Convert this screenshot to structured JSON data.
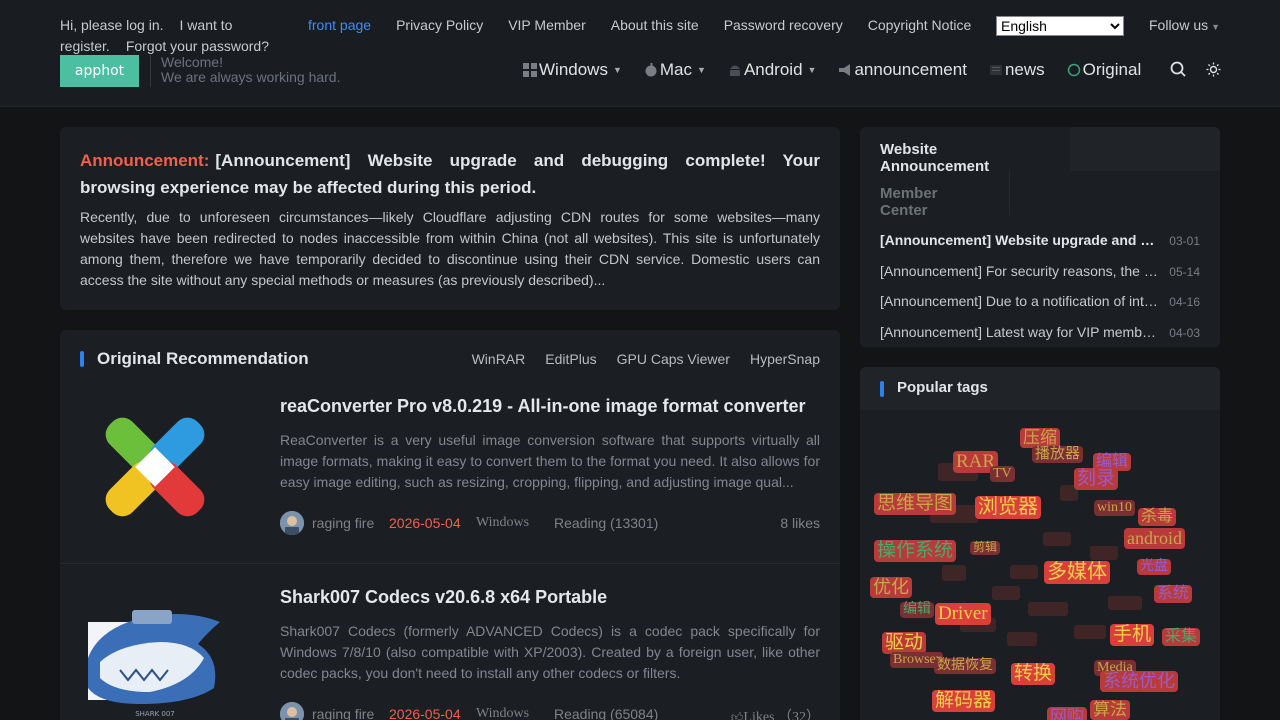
{
  "topbar": {
    "login_prompt": "Hi, please log in.",
    "i_want_to_register": "I want to register.",
    "forgot_password": "Forgot your password?",
    "links": [
      "front page",
      "Privacy Policy",
      "VIP Member",
      "About this site",
      "Password recovery",
      "Copyright Notice"
    ],
    "language_selected": "English",
    "follow_us": "Follow us"
  },
  "brand": {
    "logo_text": "apphot",
    "welcome_line1": "Welcome!",
    "welcome_line2": "We are always working hard."
  },
  "nav": {
    "windows": "Windows",
    "mac": "Mac",
    "android": "Android",
    "announcement": "announcement",
    "news": "news",
    "original": "Original"
  },
  "announcement": {
    "label": "Announcement:",
    "title": "[Announcement] Website upgrade and debugging complete! Your browsing experience may be affected during this period.",
    "body": "Recently, due to unforeseen circumstances—likely Cloudflare adjusting CDN routes for some websites—many websites have been redirected to nodes inaccessible from within China (not all websites). This site is unfortunately among them, therefore we have temporarily decided to discontinue using their CDN service. Domestic users can access the site without any special methods or measures (as previously described)..."
  },
  "recommendation": {
    "title": "Original Recommendation",
    "tabs": [
      "WinRAR",
      "EditPlus",
      "GPU Caps Viewer",
      "HyperSnap"
    ],
    "posts": [
      {
        "title": "reaConverter Pro v8.0.219 - All-in-one image format converter",
        "desc": "ReaConverter is a very useful image conversion software that supports virtually all image formats, making it easy to convert them to the format you need. It also allows for easy image editing, such as resizing, cropping, flipping, and adjusting image qual...",
        "author": "raging fire",
        "date": "2026-05-04",
        "category": "Windows",
        "reads": "Reading (13301)",
        "likes": "8   likes"
      },
      {
        "title": "Shark007 Codecs v20.6.8 x64 Portable",
        "desc": "Shark007 Codecs (formerly ADVANCED Codecs) is a codec pack specifically for Windows 7/8/10 (also compatible with XP/2003). Created by a foreign user, like other codec packs, you don't need to install any other codecs or filters.",
        "author": "raging fire",
        "date": "2026-05-04",
        "category": "Windows",
        "reads": "Reading (65084)",
        "likes": "Likes （32）",
        "thumb_caption": "SHARK 007"
      }
    ]
  },
  "website_announcement": {
    "tab_active": "Website Announcement",
    "tab_member": "Member Center",
    "items": [
      {
        "title": "[Announcement] Website upgrade and debugging complete!",
        "date": "03-01"
      },
      {
        "title": "[Announcement] For security reasons, the website has been updated",
        "date": "05-14"
      },
      {
        "title": "[Announcement] Due to a notification of interruption of service",
        "date": "04-16"
      },
      {
        "title": "[Announcement] Latest way for VIP members to get access",
        "date": "04-03"
      }
    ]
  },
  "popular_tags": {
    "title": "Popular tags",
    "tags": [
      {
        "text": "压缩",
        "color": "#c9a64a",
        "bg": "#b83a3a"
      },
      {
        "text": "RAR",
        "color": "#c9a64a",
        "bg": "#b83a3a"
      },
      {
        "text": "播放器",
        "color": "#c9a64a",
        "bg": "#7a2f32"
      },
      {
        "text": "编辑",
        "color": "#9a5bc8",
        "bg": "#b83a3a"
      },
      {
        "text": "TV",
        "color": "#c9a64a",
        "bg": "#7a2f32"
      },
      {
        "text": "刻录",
        "color": "#9a5bc8",
        "bg": "#b83a3a"
      },
      {
        "text": "思维导图",
        "color": "#c9a64a",
        "bg": "#b83a3a"
      },
      {
        "text": "浏览器",
        "color": "#f0d04a",
        "bg": "#d9403a"
      },
      {
        "text": "win10",
        "color": "#c9a64a",
        "bg": "#7a2f32"
      },
      {
        "text": "杀毒",
        "color": "#c9a64a",
        "bg": "#b83a3a"
      },
      {
        "text": "android",
        "color": "#c9a64a",
        "bg": "#b83a3a"
      },
      {
        "text": "操作系统",
        "color": "#4aa86a",
        "bg": "#b83a3a"
      },
      {
        "text": "剪辑",
        "color": "#c9a64a",
        "bg": "#7a2f32"
      },
      {
        "text": "多媒体",
        "color": "#f0d04a",
        "bg": "#d9403a"
      },
      {
        "text": "光盘",
        "color": "#9a5bc8",
        "bg": "#b83a3a"
      },
      {
        "text": "优化",
        "color": "#c9a64a",
        "bg": "#b83a3a"
      },
      {
        "text": "系统",
        "color": "#9a5bc8",
        "bg": "#b83a3a"
      },
      {
        "text": "编辑",
        "color": "#4aa86a",
        "bg": "#7a2f32"
      },
      {
        "text": "Driver",
        "color": "#f0d04a",
        "bg": "#d9403a"
      },
      {
        "text": "驱动",
        "color": "#f0d04a",
        "bg": "#b83a3a"
      },
      {
        "text": "手机",
        "color": "#f0d04a",
        "bg": "#d9403a"
      },
      {
        "text": "采集",
        "color": "#4aa86a",
        "bg": "#b83a3a"
      },
      {
        "text": "Browser",
        "color": "#c9a64a",
        "bg": "#7a2f32"
      },
      {
        "text": "数据恢复",
        "color": "#c9a64a",
        "bg": "#7a2f32"
      },
      {
        "text": "转换",
        "color": "#f0d04a",
        "bg": "#d9403a"
      },
      {
        "text": "Media",
        "color": "#c9a64a",
        "bg": "#7a2f32"
      },
      {
        "text": "系统优化",
        "color": "#9a5bc8",
        "bg": "#b83a3a"
      },
      {
        "text": "解码器",
        "color": "#f0d04a",
        "bg": "#d9403a"
      },
      {
        "text": "网购",
        "color": "#9a5bc8",
        "bg": "#b83a3a"
      },
      {
        "text": "算法",
        "color": "#c9a64a",
        "bg": "#b83a3a"
      }
    ]
  }
}
